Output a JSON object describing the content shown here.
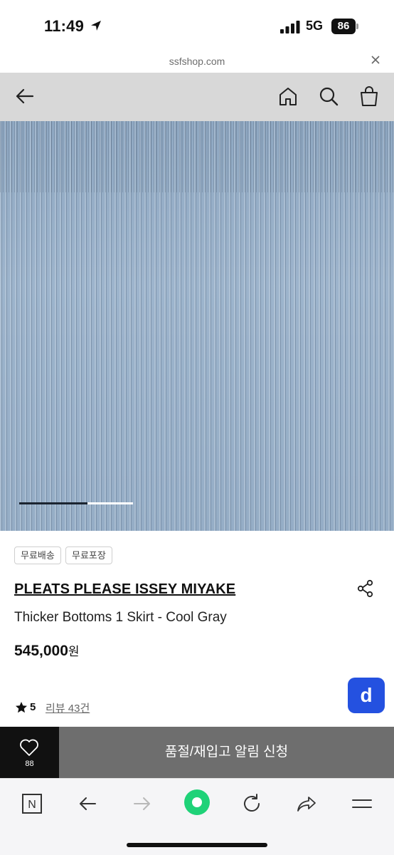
{
  "status_bar": {
    "time": "11:49",
    "network": "5G",
    "battery": "86"
  },
  "url_bar": {
    "url": "ssfshop.com"
  },
  "product": {
    "gallery_progress": 0.6,
    "tags": [
      "무료배송",
      "무료포장"
    ],
    "brand": "PLEATS PLEASE ISSEY MIYAKE",
    "name": "Thicker Bottoms 1 Skirt - Cool Gray",
    "price": "545,000",
    "price_unit": "원",
    "rating": "5",
    "review_label": "리뷰 43건"
  },
  "floating_button": {
    "label": "d",
    "color": "#2451e0"
  },
  "action_bar": {
    "like_count": "88",
    "restock_label": "품절/재입고 알림 신청"
  },
  "icons": [
    "back-arrow-icon",
    "home-icon",
    "search-icon",
    "shopping-bag-icon",
    "share-icon",
    "heart-icon",
    "star-icon",
    "close-icon"
  ],
  "browser_toolbar": {
    "n_label": "N"
  }
}
